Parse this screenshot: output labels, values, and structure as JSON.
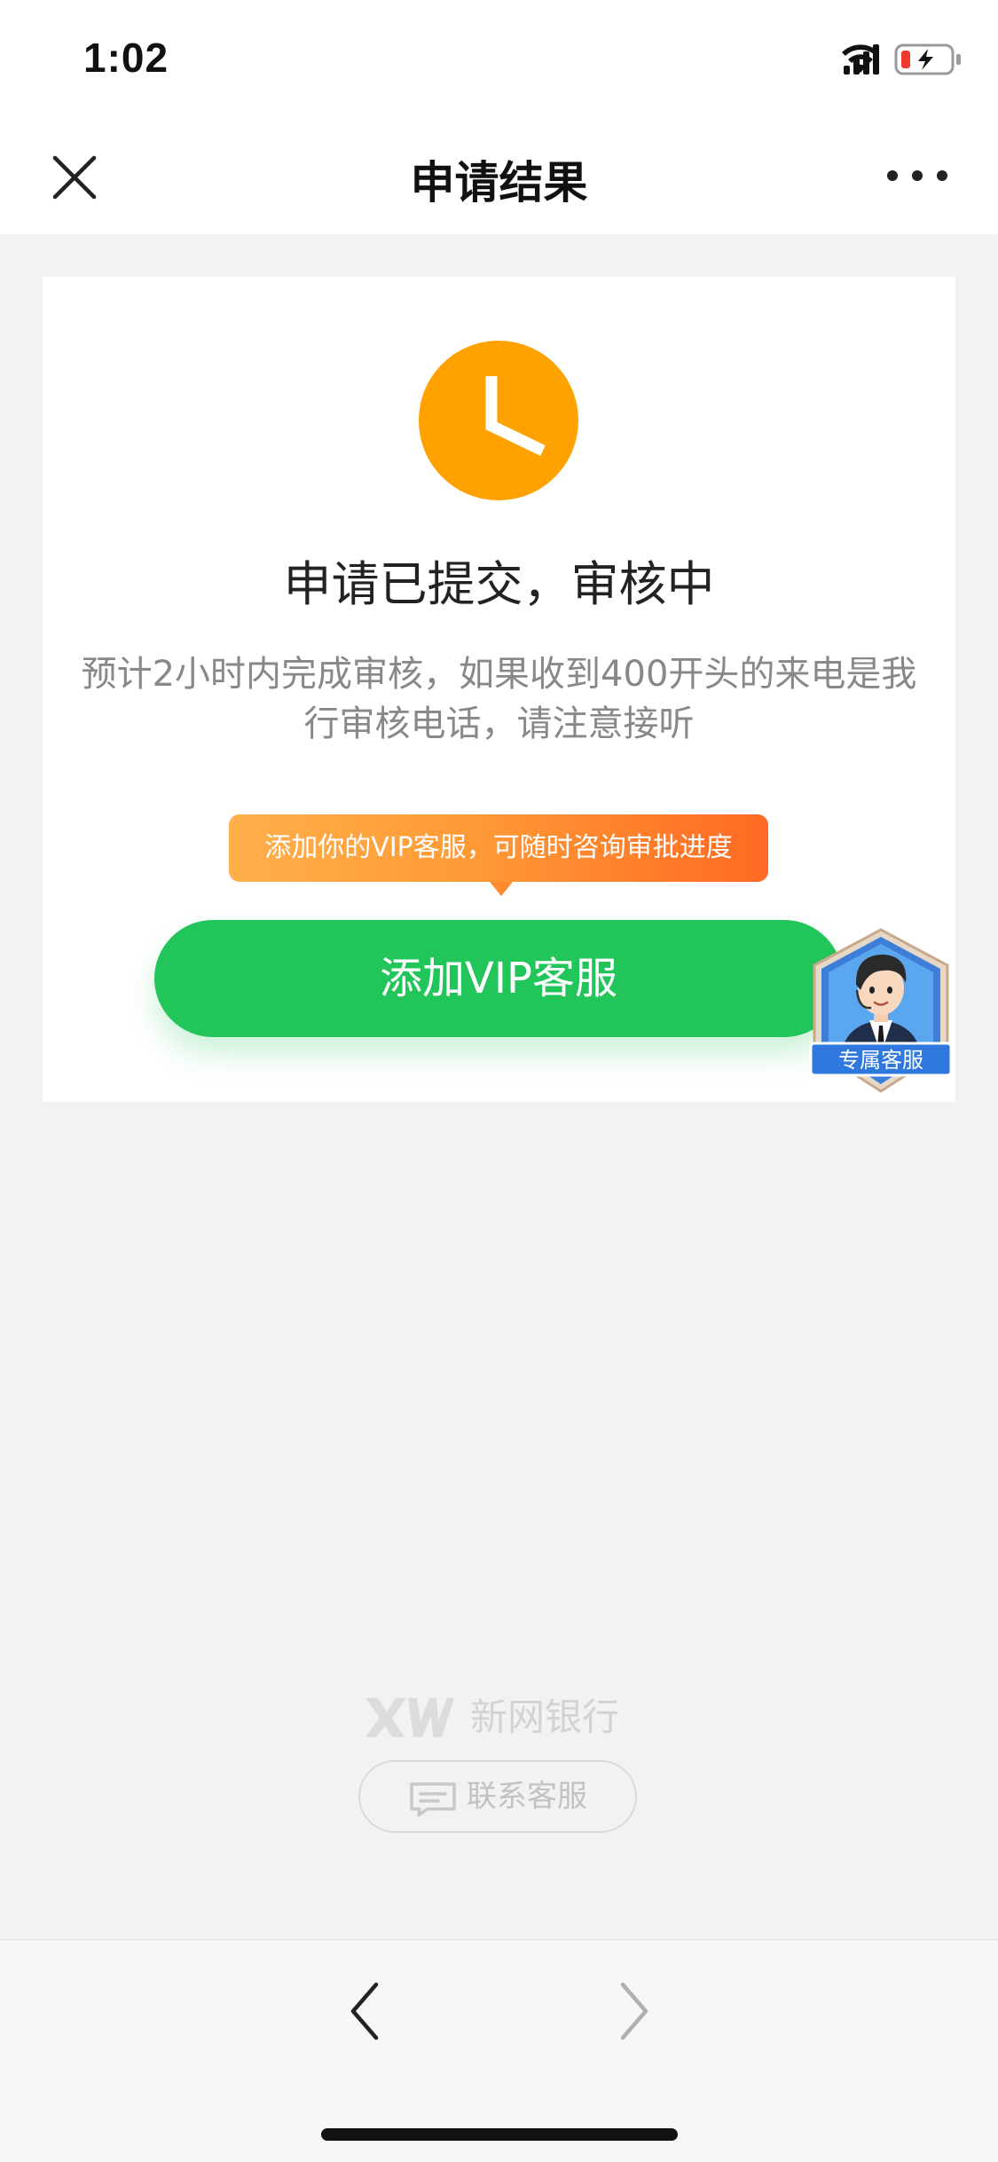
{
  "status_bar": {
    "time": "1:02"
  },
  "nav": {
    "title": "申请结果"
  },
  "result": {
    "title": "申请已提交，审核中",
    "description": "预计2小时内完成审核，如果收到400开头的来电是我行审核电话，请注意接听"
  },
  "tooltip": {
    "text": "添加你的VIP客服，可随时咨询审批进度"
  },
  "vip_button": {
    "label": "添加VIP客服"
  },
  "vip_badge": {
    "label": "专属客服"
  },
  "footer": {
    "brand_name": "新网银行",
    "contact_label": "联系客服"
  },
  "colors": {
    "accent_green": "#21c55a",
    "clock_orange": "#ffa200",
    "tooltip_orange": "#ff7a2a"
  }
}
